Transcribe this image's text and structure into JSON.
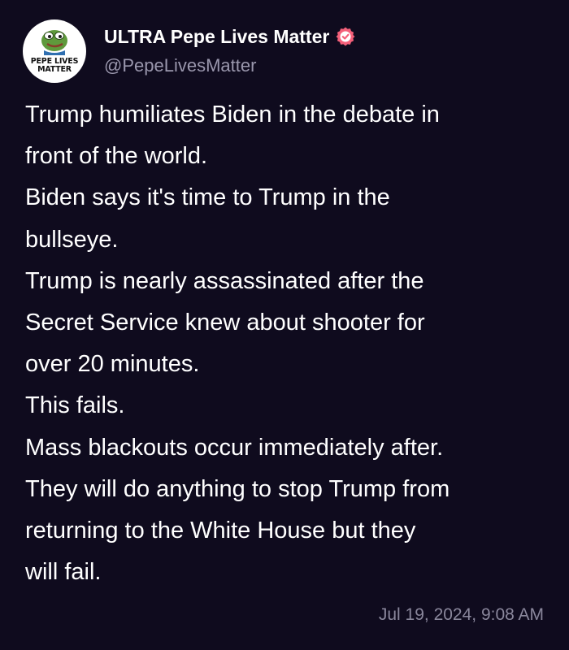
{
  "account": {
    "display_name": "ULTRA Pepe Lives Matter",
    "handle": "@PepeLivesMatter",
    "avatar_text_line1": "PEPE LIVES",
    "avatar_text_line2": "MATTER",
    "verified_icon": "verified-badge-icon",
    "verified_color": "#f4607a"
  },
  "post": {
    "lines": [
      "Trump humiliates Biden in the debate in",
      "front of the world.",
      "Biden says it's time to Trump in the",
      "bullseye.",
      "Trump is nearly assassinated after the",
      "Secret Service knew about shooter for",
      "over 20 minutes.",
      "This fails.",
      "Mass blackouts occur immediately after.",
      "They will do anything to stop Trump from",
      "returning to the White House but they",
      "will fail."
    ],
    "timestamp": "Jul 19, 2024, 9:08 AM"
  },
  "colors": {
    "background": "#0f0b1e",
    "text": "#ffffff",
    "muted": "#9a97ad"
  }
}
